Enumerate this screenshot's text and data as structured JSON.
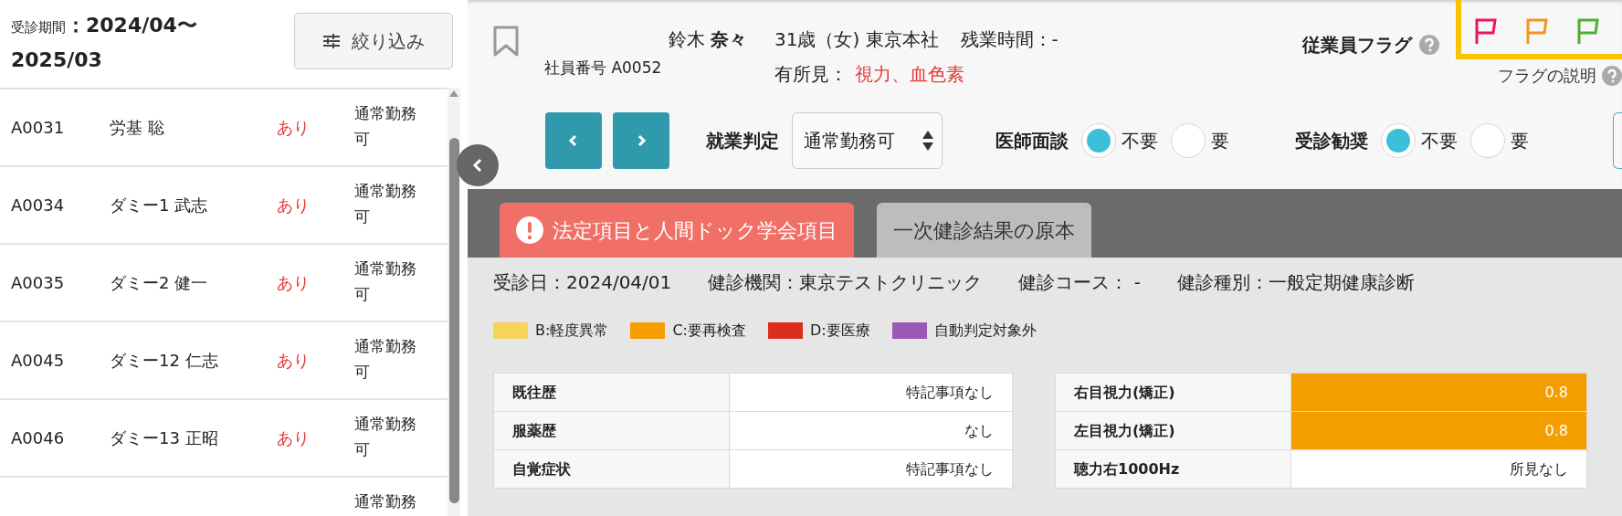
{
  "sidebar": {
    "period": "受診期間**：2024/04〜 2025/03**",
    "filter_button": "絞り込み",
    "employees": [
      {
        "id": "A0031",
        "name": "労基 聡",
        "findings": "あり",
        "judgement": "通常勤務可"
      },
      {
        "id": "A0034",
        "name": "ダミー1 武志",
        "findings": "あり",
        "judgement": "通常勤務可"
      },
      {
        "id": "A0035",
        "name": "ダミー2 健一",
        "findings": "あり",
        "judgement": "通常勤務可"
      },
      {
        "id": "A0045",
        "name": "ダミー12 仁志",
        "findings": "あり",
        "judgement": "通常勤務可"
      },
      {
        "id": "A0046",
        "name": "ダミー13 正昭",
        "findings": "あり",
        "judgement": "通常勤務可"
      },
      {
        "judgement": "通常勤務"
      }
    ]
  },
  "header": {
    "name": "鈴木 **奈々**",
    "employee_number": "社員番号 A0052",
    "profile": "31歳（女) 東京本社",
    "overtime": "残業時間：-",
    "findings_label": "有所見：",
    "findings_value": "視力、血色素",
    "flag_label": "従業員フラグ",
    "flags": [
      {
        "color": "#e8175d"
      },
      {
        "color": "#f7931e"
      },
      {
        "color": "#4caf33"
      }
    ],
    "flag_help": "フラグの説明"
  },
  "controls": {
    "judgement_label": "就業判定",
    "judgement_value": "通常勤務可",
    "radio_groups": [
      {
        "label": "医師面談",
        "options": [
          {
            "label": "不要",
            "selected": true
          },
          {
            "label": "要",
            "selected": false
          }
        ]
      },
      {
        "label": "受診勧奨",
        "options": [
          {
            "label": "不要",
            "selected": true
          },
          {
            "label": "要",
            "selected": false
          }
        ]
      }
    ]
  },
  "tabs": [
    {
      "label": "法定項目と人間ドック学会項目",
      "selected": true,
      "warning": true
    },
    {
      "label": "一次健診結果の原本",
      "selected": false,
      "warning": false
    }
  ],
  "exam_info": [
    "受診日：2024/04/01",
    "健診機関：東京テストクリニック",
    "健診コース： -",
    "健診種別：一般定期健康診断"
  ],
  "legend": [
    {
      "label": "B:軽度異常",
      "color": "#f7d358"
    },
    {
      "label": "C:要再検査",
      "color": "#f59e00"
    },
    {
      "label": "D:要医療",
      "color": "#dc2d1e"
    },
    {
      "label": "自動判定対象外",
      "color": "#9b59b6"
    }
  ],
  "tables": [
    {
      "rows": [
        {
          "label": "既往歴",
          "value": "特記事項なし"
        },
        {
          "label": "服薬歴",
          "value": "なし"
        },
        {
          "label": "自覚症状",
          "value": "特記事項なし"
        }
      ]
    },
    {
      "rows": [
        {
          "label": "右目視力(矯正)",
          "value": "0.8",
          "color": "#f59e00"
        },
        {
          "label": "左目視力(矯正)",
          "value": "0.8",
          "color": "#f59e00"
        },
        {
          "label": "聴力右1000Hz",
          "value": "所見なし"
        }
      ]
    }
  ]
}
